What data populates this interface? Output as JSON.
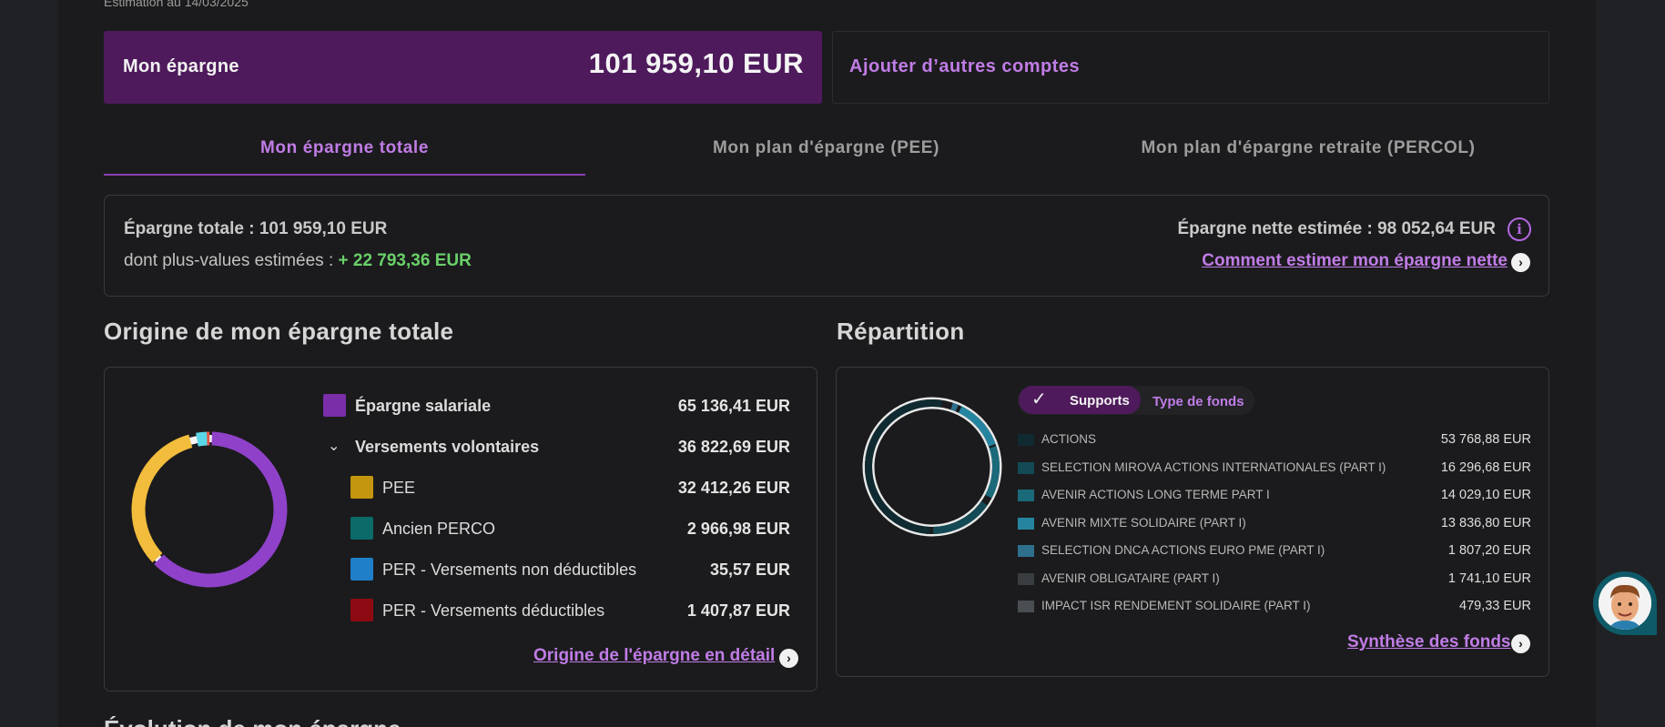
{
  "header": {
    "estimation": "Estimation au 14/03/2025",
    "savings_label": "Mon épargne",
    "savings_amount": "101 959,10 EUR",
    "add_accounts": "Ajouter d’autres comptes"
  },
  "tabs": [
    {
      "label": "Mon épargne totale",
      "active": true
    },
    {
      "label": "Mon plan d'épargne (PEE)",
      "active": false
    },
    {
      "label": "Mon plan d'épargne retraite (PERCOL)",
      "active": false
    }
  ],
  "summary": {
    "total": "Épargne totale : 101 959,10 EUR",
    "gain_label": "dont plus-values estimées : ",
    "gain_value": "+ 22 793,36 EUR",
    "net": "Épargne nette estimée : 98 052,64 EUR",
    "net_link": "Comment estimer mon épargne nette"
  },
  "origin": {
    "title": "Origine de mon épargne totale",
    "rows": [
      {
        "label": "Épargne salariale",
        "value": "65 136,41 EUR",
        "color": "#7a2fa8"
      },
      {
        "label": "Versements volontaires",
        "value": "36 822,69 EUR"
      },
      {
        "label": "PEE",
        "value": "32 412,26 EUR",
        "color": "#c4950f"
      },
      {
        "label": "Ancien PERCO",
        "value": "2 966,98 EUR",
        "color": "#0b6b68"
      },
      {
        "label": "PER - Versements non déductibles",
        "value": "35,57 EUR",
        "color": "#1f7fc9"
      },
      {
        "label": "PER - Versements déductibles",
        "value": "1 407,87 EUR",
        "color": "#8e0a12"
      }
    ],
    "link": "Origine de l'épargne en détail"
  },
  "repartition": {
    "title": "Répartition",
    "toggle_on": "Supports",
    "toggle_off": "Type de fonds",
    "rows": [
      {
        "label": "ACTIONS",
        "value": "53 768,88 EUR",
        "color": "#0f2a30"
      },
      {
        "label": "SELECTION MIROVA ACTIONS INTERNATIONALES (PART I)",
        "value": "16 296,68 EUR",
        "color": "#134a55"
      },
      {
        "label": "AVENIR ACTIONS LONG TERME PART I",
        "value": "14 029,10 EUR",
        "color": "#1a6a7a"
      },
      {
        "label": "AVENIR MIXTE SOLIDAIRE (PART I)",
        "value": "13 836,80 EUR",
        "color": "#2585a0"
      },
      {
        "label": "SELECTION DNCA ACTIONS EURO PME (PART I)",
        "value": "1 807,20 EUR",
        "color": "#2e6f8c"
      },
      {
        "label": "AVENIR OBLIGATAIRE (PART I)",
        "value": "1 741,10 EUR",
        "color": "#3a3d40"
      },
      {
        "label": "IMPACT ISR RENDEMENT SOLIDAIRE (PART I)",
        "value": "479,33 EUR",
        "color": "#4a4e52"
      }
    ],
    "link": "Synthèse des fonds"
  },
  "next_section": "Évolution de mon épargne",
  "icons": {
    "info": "info-icon",
    "arrow": "chevron-right-circle-icon",
    "check": "check-icon",
    "chevron": "chevron-down-icon",
    "assistant": "assistant-avatar"
  }
}
